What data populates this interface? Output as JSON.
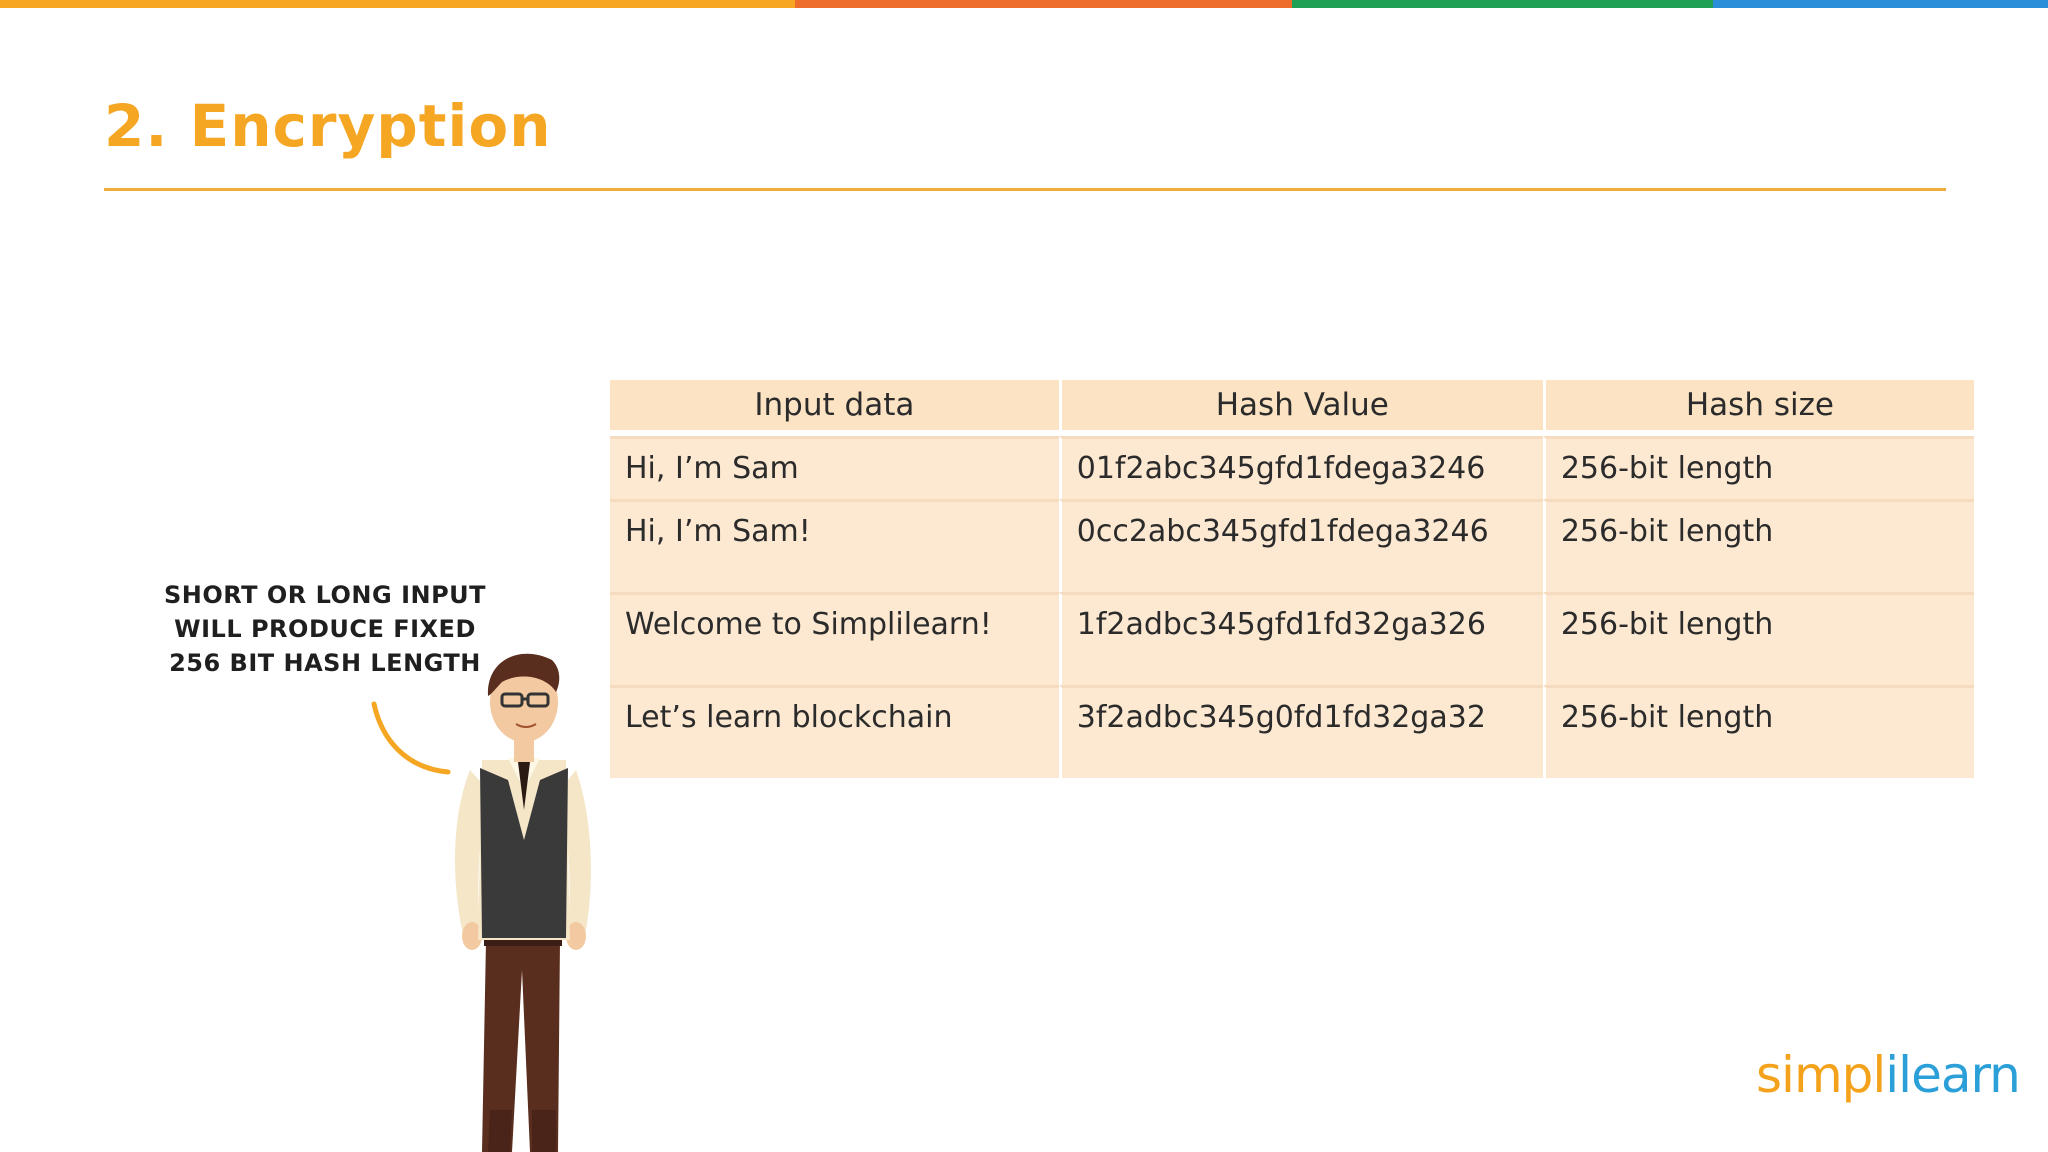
{
  "title": "2. Encryption",
  "colors": {
    "title": "#f5a623",
    "topbar": [
      "#f6a623",
      "#ef6d2c",
      "#1fa055",
      "#2a8fd8"
    ],
    "table_header_bg": "#fbe3c3",
    "table_cell_bg": "#fde9d1"
  },
  "table": {
    "headers": [
      "Input data",
      "Hash Value",
      "Hash size"
    ],
    "rows": [
      [
        "Hi, I’m Sam",
        "01f2abc345gfd1fdega3246",
        "256-bit length"
      ],
      [
        "Hi, I’m Sam!",
        "0cc2abc345gfd1fdega3246",
        "256-bit length"
      ],
      [
        "Welcome to Simplilearn!",
        "1f2adbc345gfd1fd32ga326",
        "256-bit length"
      ],
      [
        "Let’s learn blockchain",
        "3f2adbc345g0fd1fd32ga32",
        "256-bit length"
      ]
    ]
  },
  "speech_bubble": {
    "lines": [
      "Short or long input",
      "will produce fixed",
      "256 bit hash length"
    ]
  },
  "logo": {
    "part_a": "simpl",
    "part_b": "ilearn"
  }
}
